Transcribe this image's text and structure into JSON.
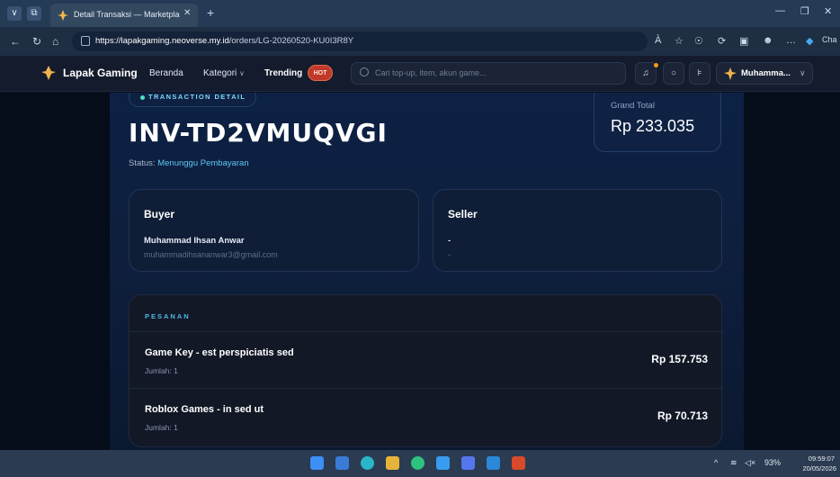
{
  "browser": {
    "tab_title": "Detail Transaksi — Marketplace Ga",
    "tab_close": "✕",
    "new_tab": "+",
    "url_domain": "https://lapakgaming.neoverse.my.id",
    "url_path": "/orders/LG-20260520-KU0I3R8Y",
    "read_aloud": "À",
    "favorites": "☆",
    "more": "…",
    "copilot_label": "Cha"
  },
  "site_nav": {
    "brand": "Lapak Gaming",
    "links": [
      "Beranda",
      "Kategori",
      "Trending"
    ],
    "kategori_chevron": "∨",
    "hot_badge": "HOT",
    "search_placeholder": "Cari top-up, item, akun game...",
    "user_name": "Muhamma...",
    "user_chevron": "∨"
  },
  "transaction": {
    "chip": "TRANSACTION DETAIL",
    "invoice": "INV-TD2VMUQVGI",
    "status_label": "Status:",
    "status_value": "Menunggu Pembayaran",
    "grand_total_label": "Grand Total",
    "grand_total_value": "Rp 233.035"
  },
  "buyer": {
    "title": "Buyer",
    "name": "Muhammad Ihsan Anwar",
    "email": "muhammadihsananwar3@gmail.com"
  },
  "seller": {
    "title": "Seller",
    "name": "-",
    "email": "-"
  },
  "orders": {
    "heading": "PESANAN",
    "items": [
      {
        "name": "Game Key - est perspiciatis sed",
        "qty": "Jumlah: 1",
        "price": "Rp 157.753"
      },
      {
        "name": "Roblox Games - in sed ut",
        "qty": "Jumlah: 1",
        "price": "Rp 70.713"
      }
    ]
  },
  "taskbar": {
    "battery": "93%",
    "time": "09:59:07",
    "date": "20/05/2026"
  },
  "colors": {
    "accent": "#5ec8f5",
    "hot": "#c0392b",
    "status": "#5ec8f5"
  }
}
